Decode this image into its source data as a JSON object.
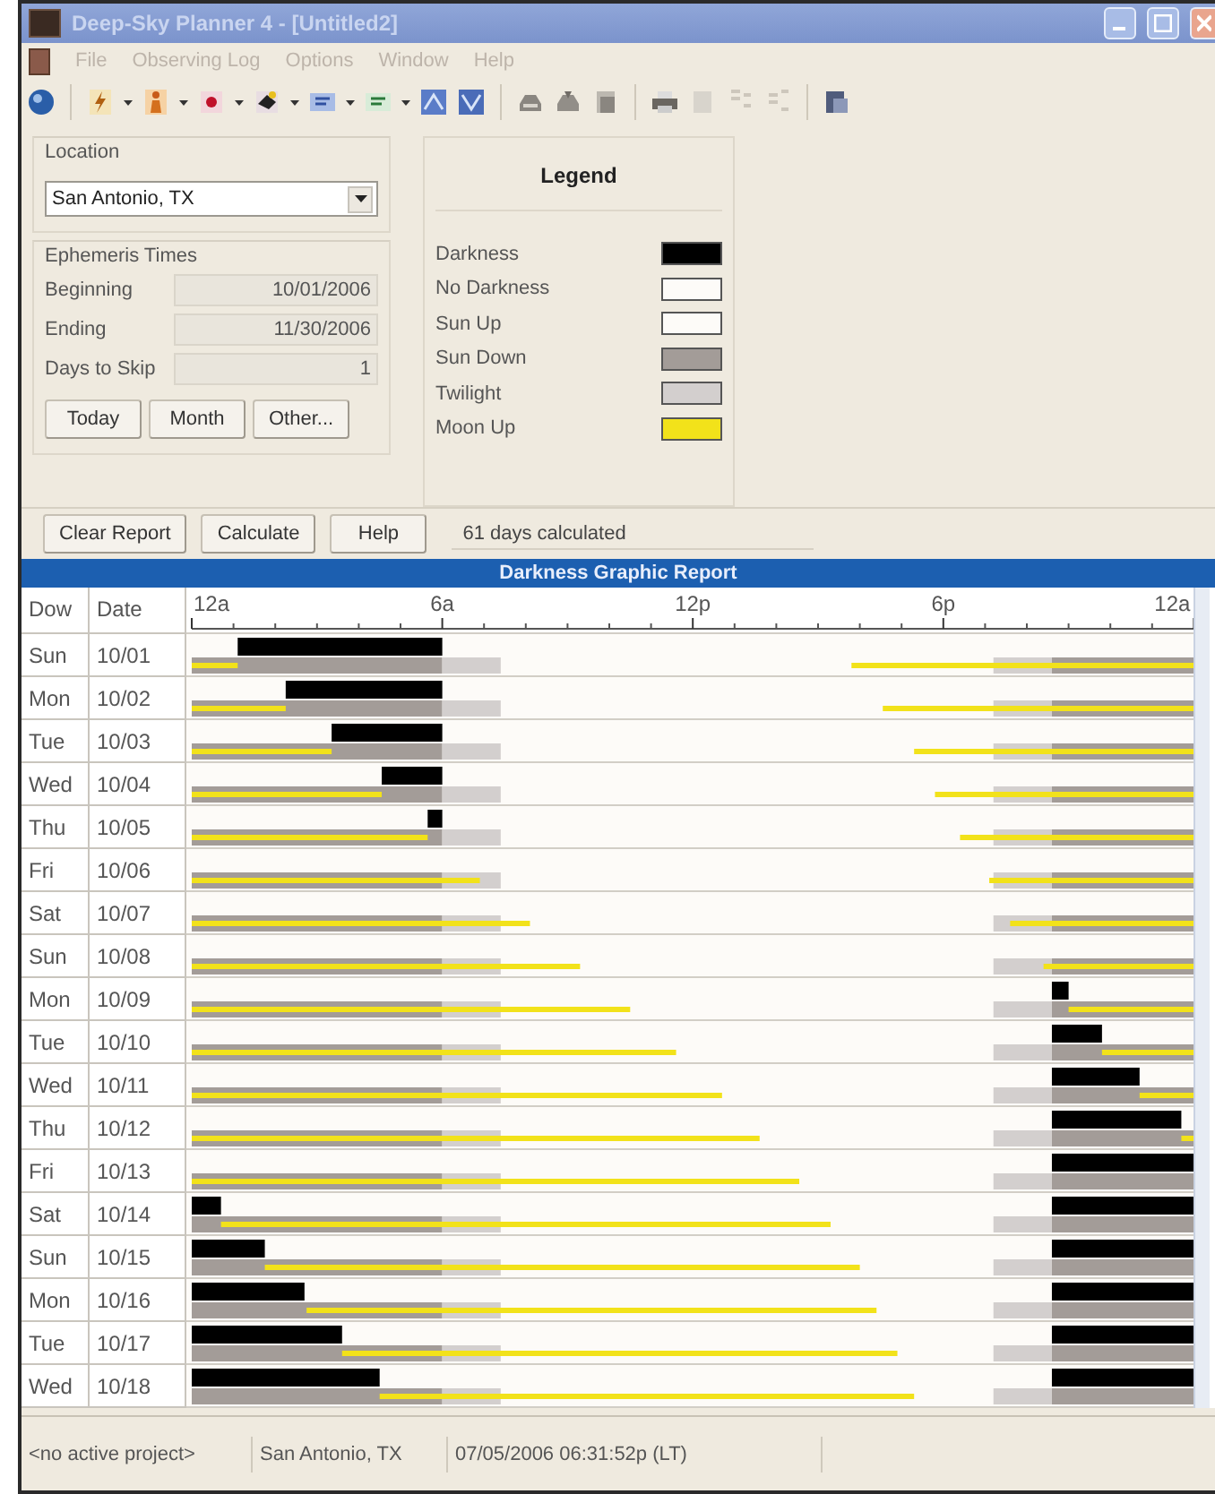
{
  "window": {
    "title": "Deep-Sky Planner 4 - [Untitled2]"
  },
  "menu": [
    "File",
    "Observing Log",
    "Options",
    "Window",
    "Help"
  ],
  "location": {
    "label": "Location",
    "value": "San Antonio, TX"
  },
  "ephemeris": {
    "title": "Ephemeris Times",
    "fields": [
      {
        "label": "Beginning",
        "value": "10/01/2006"
      },
      {
        "label": "Ending",
        "value": "11/30/2006"
      },
      {
        "label": "Days to Skip",
        "value": "1"
      }
    ],
    "buttons": [
      "Today",
      "Month",
      "Other..."
    ]
  },
  "legend": {
    "title": "Legend",
    "items": [
      {
        "label": "Darkness",
        "color": "#000000"
      },
      {
        "label": "No Darkness",
        "color": "#fdfbf8"
      },
      {
        "label": "Sun Up",
        "color": "#fdfbf8"
      },
      {
        "label": "Sun Down",
        "color": "#a39c98"
      },
      {
        "label": "Twilight",
        "color": "#d3cfce"
      },
      {
        "label": "Moon Up",
        "color": "#f2e21a"
      }
    ]
  },
  "actions": {
    "buttons": [
      "Clear Report",
      "Calculate",
      "Help"
    ],
    "status": "61 days calculated"
  },
  "report": {
    "title": "Darkness Graphic Report",
    "columns": [
      "Dow",
      "Date"
    ],
    "time_axis": [
      "12a",
      "6a",
      "12p",
      "6p",
      "12a"
    ],
    "rows": [
      {
        "dow": "Sun",
        "date": "10/01"
      },
      {
        "dow": "Mon",
        "date": "10/02"
      },
      {
        "dow": "Tue",
        "date": "10/03"
      },
      {
        "dow": "Wed",
        "date": "10/04"
      },
      {
        "dow": "Thu",
        "date": "10/05"
      },
      {
        "dow": "Fri",
        "date": "10/06"
      },
      {
        "dow": "Sat",
        "date": "10/07"
      },
      {
        "dow": "Sun",
        "date": "10/08"
      },
      {
        "dow": "Mon",
        "date": "10/09"
      },
      {
        "dow": "Tue",
        "date": "10/10"
      },
      {
        "dow": "Wed",
        "date": "10/11"
      },
      {
        "dow": "Thu",
        "date": "10/12"
      },
      {
        "dow": "Fri",
        "date": "10/13"
      },
      {
        "dow": "Sat",
        "date": "10/14"
      },
      {
        "dow": "Sun",
        "date": "10/15"
      },
      {
        "dow": "Mon",
        "date": "10/16"
      },
      {
        "dow": "Tue",
        "date": "10/17"
      },
      {
        "dow": "Wed",
        "date": "10/18"
      }
    ]
  },
  "status_bar": [
    "<no active project>",
    "San Antonio, TX",
    "07/05/2006 06:31:52p (LT)"
  ]
}
